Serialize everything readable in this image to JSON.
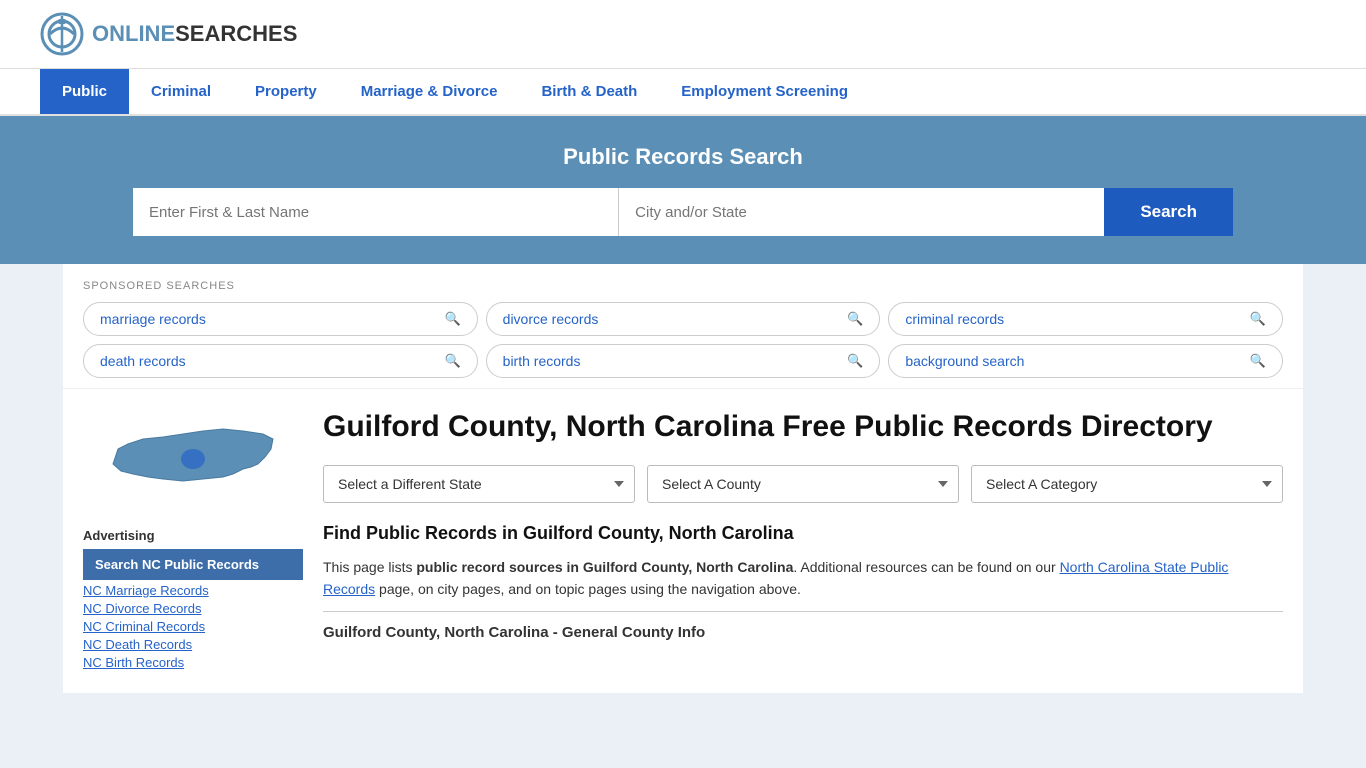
{
  "site": {
    "logo_text_plain": "ONLINE",
    "logo_text_highlight": "SEARCHES"
  },
  "nav": {
    "items": [
      {
        "label": "Public",
        "active": true
      },
      {
        "label": "Criminal",
        "active": false
      },
      {
        "label": "Property",
        "active": false
      },
      {
        "label": "Marriage & Divorce",
        "active": false
      },
      {
        "label": "Birth & Death",
        "active": false
      },
      {
        "label": "Employment Screening",
        "active": false
      }
    ]
  },
  "search_banner": {
    "title": "Public Records Search",
    "name_placeholder": "Enter First & Last Name",
    "location_placeholder": "City and/or State",
    "button_label": "Search"
  },
  "sponsored": {
    "label": "SPONSORED SEARCHES",
    "tags": [
      "marriage records",
      "divorce records",
      "criminal records",
      "death records",
      "birth records",
      "background search"
    ]
  },
  "page": {
    "title": "Guilford County, North Carolina Free Public Records Directory",
    "dropdowns": {
      "state_label": "Select a Different State",
      "county_label": "Select A County",
      "category_label": "Select A Category"
    },
    "find_title": "Find Public Records in Guilford County, North Carolina",
    "find_description_1": "This page lists ",
    "find_description_bold": "public record sources in Guilford County, North Carolina",
    "find_description_2": ". Additional resources can be found on our ",
    "find_link_text": "North Carolina State Public Records",
    "find_description_3": " page, on city pages, and on topic pages using the navigation above.",
    "county_info_title": "Guilford County, North Carolina - General County Info"
  },
  "sidebar": {
    "advertising_label": "Advertising",
    "featured_link": "Search NC Public Records",
    "links": [
      "NC Marriage Records",
      "NC Divorce Records",
      "NC Criminal Records",
      "NC Death Records",
      "NC Birth Records"
    ]
  }
}
